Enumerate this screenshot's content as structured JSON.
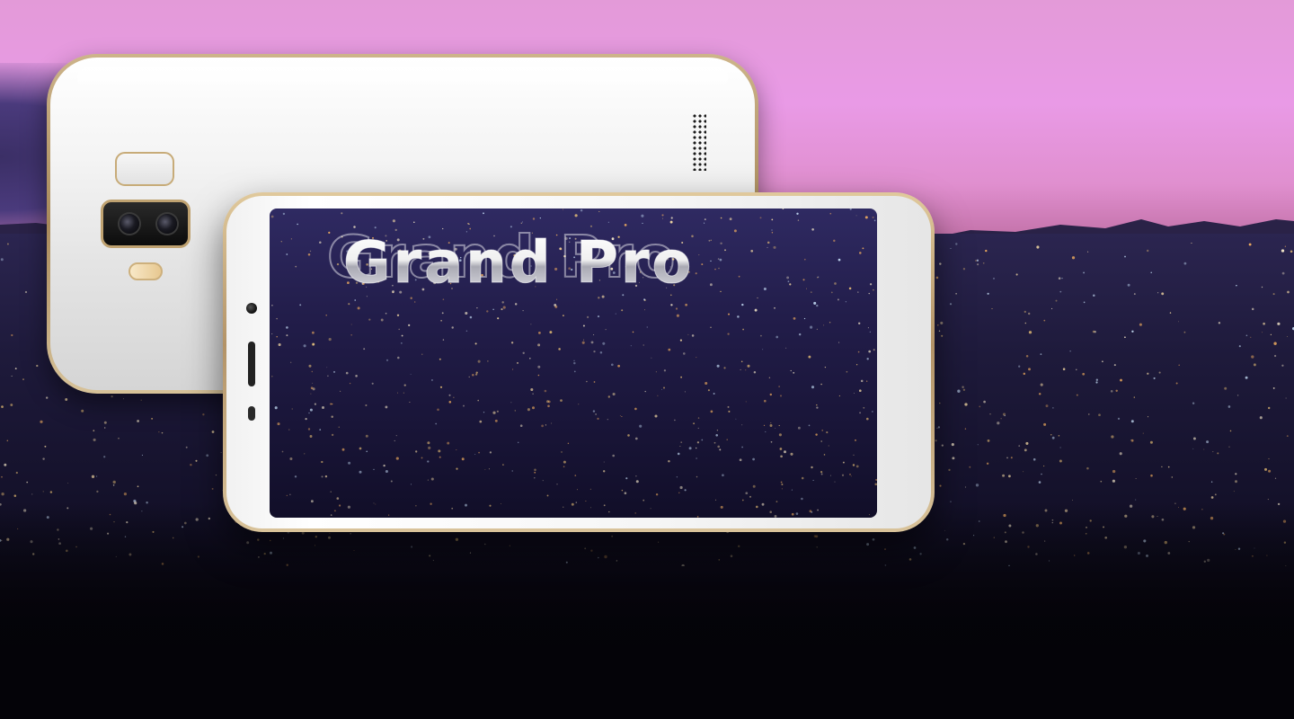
{
  "hero": {
    "title": "Grand Pro",
    "colors": {
      "sky_top": "#e39ad8",
      "sky_horizon": "#c06fa5",
      "city_night": "#1e1a3b",
      "phone_body": "#f4f4f4",
      "phone_trim_gold": "#c7ab78",
      "city_light": "#ffd27a"
    }
  },
  "phone_back": {
    "icons": [
      "flash-icon",
      "dual-camera-icon",
      "led-flash-icon",
      "speaker-grille-icon"
    ]
  },
  "phone_front": {
    "icons": [
      "front-camera-icon",
      "earpiece-icon",
      "proximity-sensor-icon"
    ]
  }
}
